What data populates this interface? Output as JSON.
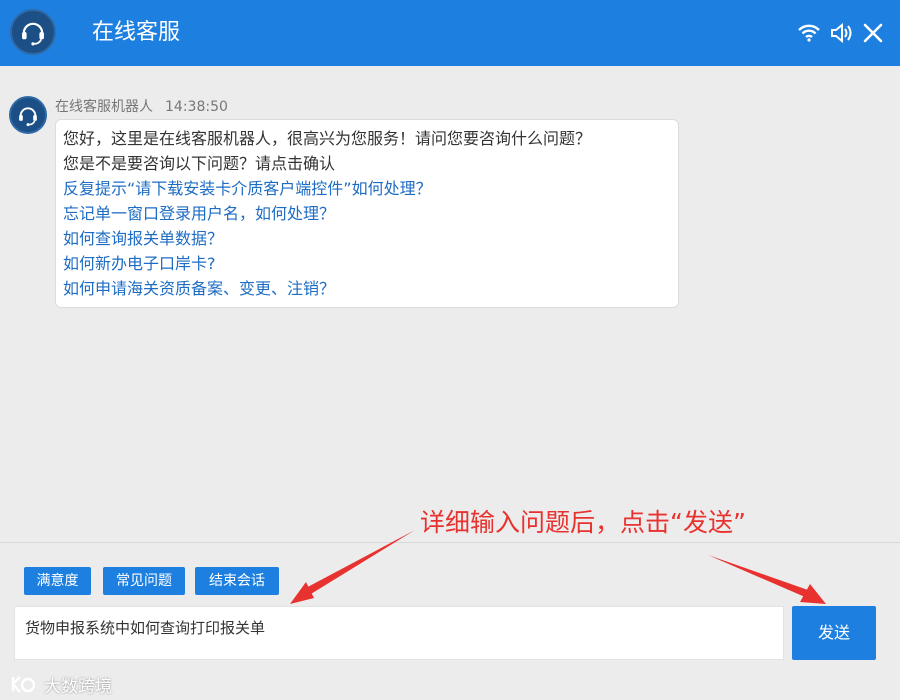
{
  "header": {
    "title": "在线客服",
    "icons": [
      "headset-icon",
      "wifi-icon",
      "speaker-icon",
      "close-icon"
    ]
  },
  "message": {
    "sender": "在线客服机器人",
    "time": "14:38:50",
    "lines": [
      "您好，这里是在线客服机器人，很高兴为您服务！请问您要咨询什么问题？",
      "您是不是要咨询以下问题？请点击确认"
    ],
    "links": [
      "反复提示“请下载安装卡介质客户端控件”如何处理？",
      "忘记单一窗口登录用户名，如何处理？",
      "如何查询报关单数据？",
      "如何新办电子口岸卡?",
      "如何申请海关资质备案、变更、注销？"
    ]
  },
  "quick_buttons": [
    "满意度",
    "常见问题",
    "结束会话"
  ],
  "input": {
    "value": "货物申报系统中如何查询打印报关单"
  },
  "send_label": "发送",
  "annotation": "详细输入问题后，点击“发送”",
  "watermark": "大数跨境",
  "colors": {
    "primary": "#1d7fe0",
    "link": "#1e6cc4",
    "annotation": "#e8322f",
    "avatar": "#1b4f85"
  }
}
